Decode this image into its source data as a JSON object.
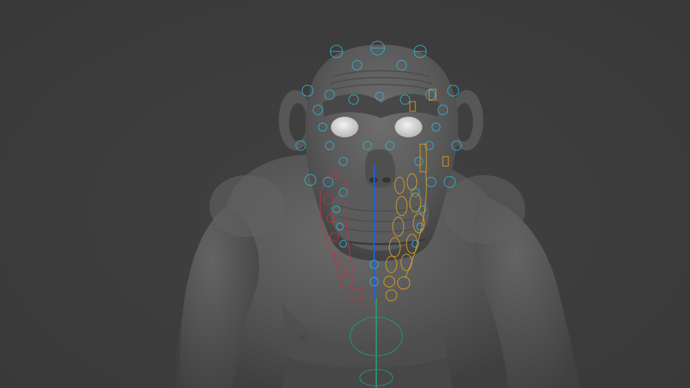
{
  "viewport": {
    "background_color": "#3d3d3d",
    "subject": "chimpanzee-sculpt",
    "overlay": "facial-rig-controls",
    "rig_colors": {
      "center": "#2fb4d8",
      "left": "#e0a020",
      "right": "#c0304a",
      "spine": "#2060e0",
      "body_line": "#20b070"
    }
  }
}
